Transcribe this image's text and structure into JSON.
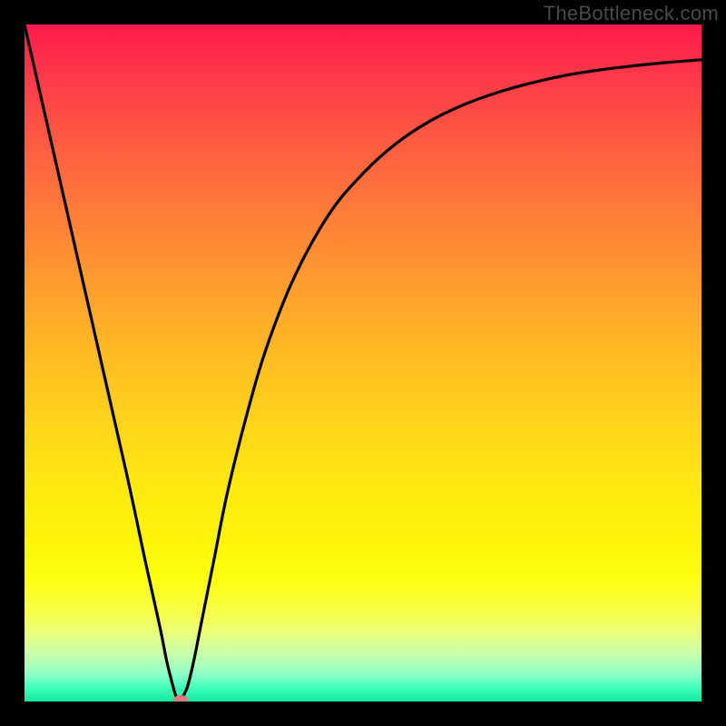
{
  "watermark": "TheBottleneck.com",
  "chart_data": {
    "type": "line",
    "title": "",
    "xlabel": "",
    "ylabel": "",
    "xlim": [
      0,
      100
    ],
    "ylim": [
      0,
      100
    ],
    "grid": false,
    "legend": false,
    "series": [
      {
        "name": "curve",
        "x": [
          0,
          5,
          10,
          15,
          18,
          20,
          21,
          22,
          22.5,
          23,
          24,
          25,
          26,
          28,
          30,
          33,
          36,
          40,
          45,
          50,
          55,
          60,
          65,
          70,
          75,
          80,
          85,
          90,
          95,
          100
        ],
        "values": [
          100,
          78,
          56,
          34,
          20,
          11,
          6,
          2,
          0.5,
          0.3,
          2,
          6,
          11,
          21,
          31,
          43,
          53,
          63,
          72,
          78,
          82.5,
          85.8,
          88.2,
          90,
          91.4,
          92.5,
          93.3,
          93.9,
          94.4,
          94.8
        ]
      }
    ],
    "marker": {
      "x": 23,
      "y": 0.3,
      "color": "#d97b7d"
    },
    "background_gradient": {
      "top": "#ff1a4b",
      "middle": "#ffe812",
      "bottom": "#14e79d"
    }
  }
}
